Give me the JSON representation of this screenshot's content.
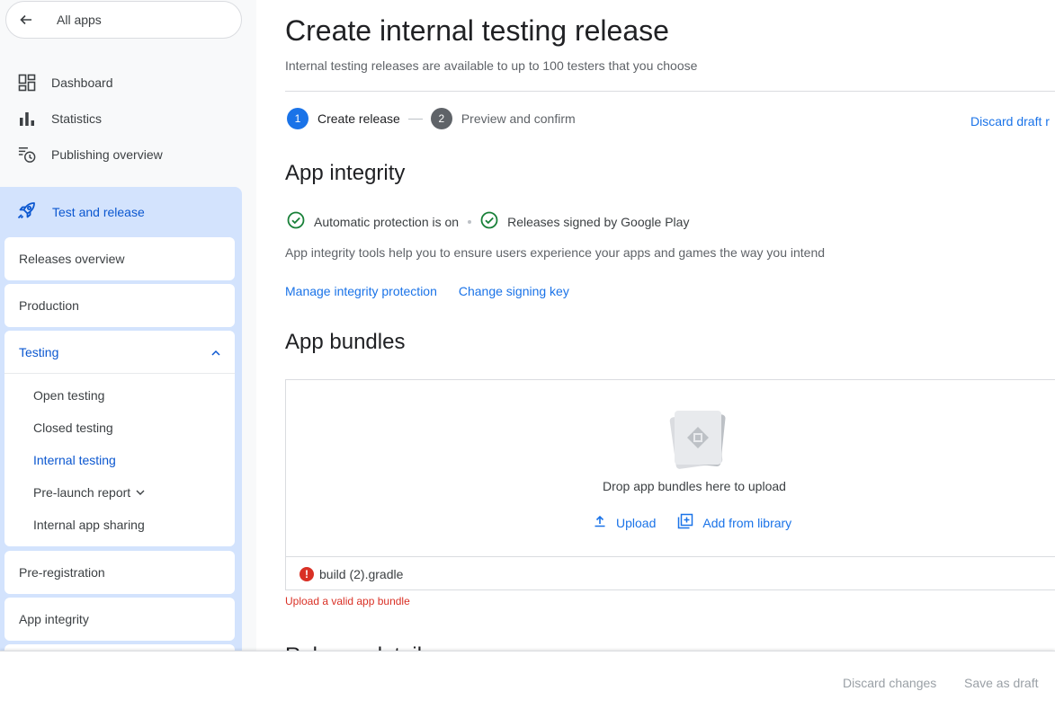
{
  "sidebar": {
    "all_apps_label": "All apps",
    "top_items": [
      {
        "label": "Dashboard",
        "icon": "dashboard-icon"
      },
      {
        "label": "Statistics",
        "icon": "bar-chart-icon"
      },
      {
        "label": "Publishing overview",
        "icon": "publishing-clock-icon"
      }
    ],
    "section": {
      "label": "Test and release",
      "icon": "rocket-icon"
    },
    "releases_overview": "Releases overview",
    "production": "Production",
    "testing": {
      "label": "Testing",
      "expanded": true,
      "items": [
        {
          "label": "Open testing",
          "active": false
        },
        {
          "label": "Closed testing",
          "active": false
        },
        {
          "label": "Internal testing",
          "active": true
        },
        {
          "label": "Pre-launch report",
          "active": false
        },
        {
          "label": "Internal app sharing",
          "active": false
        }
      ]
    },
    "pre_registration": "Pre-registration",
    "app_integrity": "App integrity"
  },
  "main": {
    "title": "Create internal testing release",
    "subtitle": "Internal testing releases are available to up to 100 testers that you choose",
    "steps": [
      {
        "number": "1",
        "label": "Create release",
        "active": true
      },
      {
        "number": "2",
        "label": "Preview and confirm",
        "active": false
      }
    ],
    "discard_link": "Discard draft r",
    "app_integrity": {
      "heading": "App integrity",
      "status": [
        "Automatic protection is on",
        "Releases signed by Google Play"
      ],
      "description": "App integrity tools help you to ensure users experience your apps and games the way you intend",
      "links": [
        "Manage integrity protection",
        "Change signing key"
      ]
    },
    "app_bundles": {
      "heading": "App bundles",
      "drop_text": "Drop app bundles here to upload",
      "upload_label": "Upload",
      "library_label": "Add from library",
      "file_name": "build (2).gradle",
      "error": "Upload a valid app bundle"
    },
    "next_heading": "Release details"
  },
  "footer": {
    "discard_changes": "Discard changes",
    "save_draft": "Save as draft"
  },
  "colors": {
    "accent": "#1a73e8",
    "nav_active_bg": "#d3e3fd",
    "success": "#188038",
    "error": "#d93025"
  }
}
